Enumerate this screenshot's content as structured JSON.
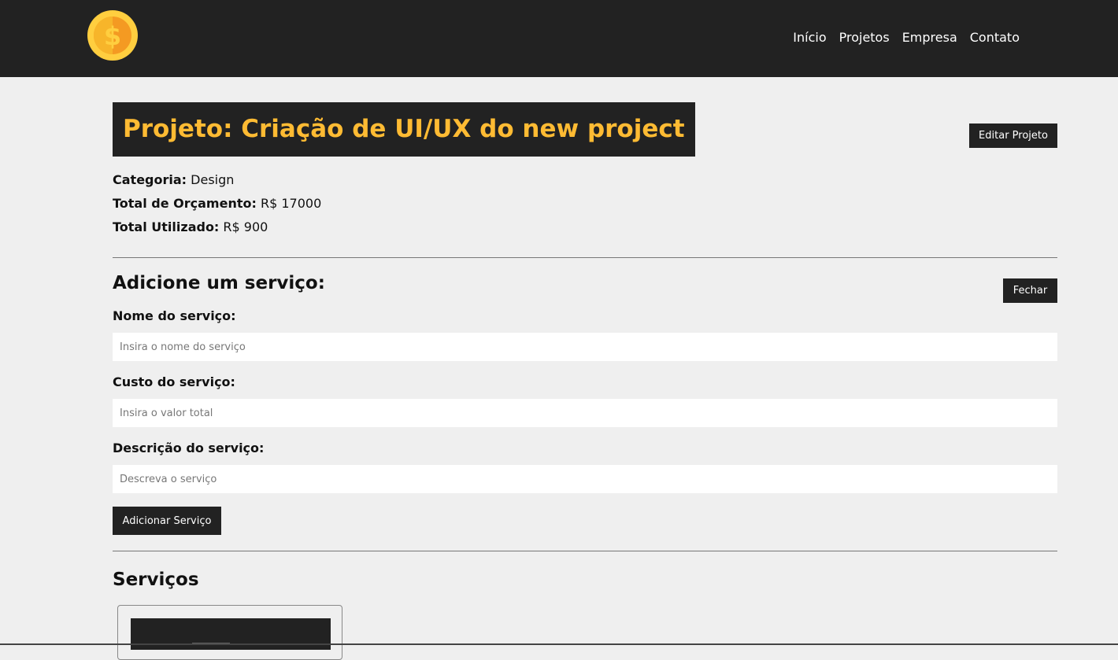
{
  "brand": {
    "logo_symbol": "$",
    "coin_outer_color": "#ffce3f",
    "coin_inner_color": "#f49a22"
  },
  "nav": {
    "items": [
      {
        "label": "Início"
      },
      {
        "label": "Projetos"
      },
      {
        "label": "Empresa"
      },
      {
        "label": "Contato"
      }
    ]
  },
  "project": {
    "title": "Projeto: Criação de UI/UX do new project",
    "edit_button_label": "Editar Projeto",
    "category_label": "Categoria:",
    "category_value": "Design",
    "budget_label": "Total de Orçamento:",
    "budget_value": "R$ 17000",
    "used_label": "Total Utilizado:",
    "used_value": "R$ 900"
  },
  "service_form": {
    "heading": "Adicione um serviço:",
    "close_button_label": "Fechar",
    "name_label": "Nome do serviço:",
    "name_placeholder": "Insira o nome do serviço",
    "cost_label": "Custo do serviço:",
    "cost_placeholder": "Insira o valor total",
    "description_label": "Descrição do serviço:",
    "description_placeholder": "Descreva o serviço",
    "submit_label": "Adicionar Serviço"
  },
  "services": {
    "heading": "Serviços"
  },
  "colors": {
    "navbar_bg": "#222222",
    "page_bg": "#efefef",
    "accent": "#ffbb33"
  }
}
